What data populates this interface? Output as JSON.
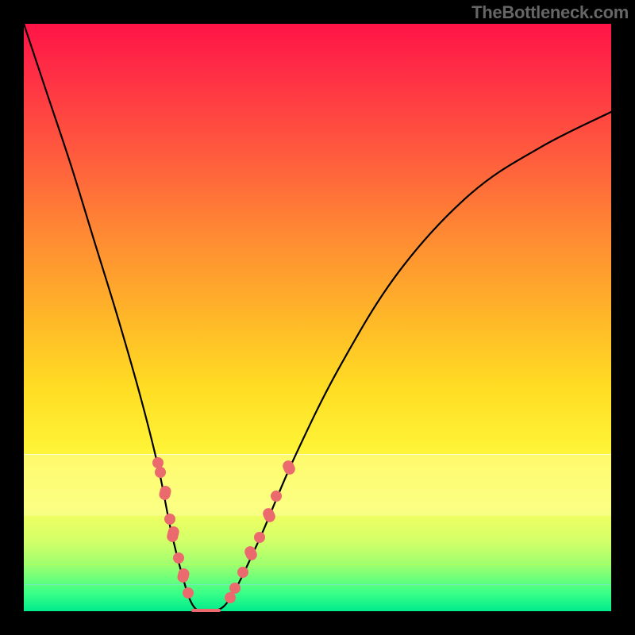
{
  "watermark": "TheBottleneck.com",
  "colors": {
    "dot": "#ea6a6e",
    "curve": "#000000",
    "gradient_top": "#ff1447",
    "gradient_bottom": "#00eb8c"
  },
  "chart_data": {
    "type": "line",
    "title": "",
    "xlabel": "",
    "ylabel": "",
    "xlim": [
      0,
      100
    ],
    "ylim": [
      0,
      100
    ],
    "series": [
      {
        "name": "bottleneck-curve",
        "x": [
          0,
          4,
          8,
          12,
          16,
          20,
          23,
          25,
          27,
          28.5,
          30,
          32,
          35,
          40,
          46,
          54,
          64,
          76,
          88,
          100
        ],
        "y": [
          100,
          88,
          76,
          63,
          50,
          36,
          24,
          14,
          6,
          1.5,
          0,
          0,
          2,
          12,
          26,
          42,
          58,
          71,
          79,
          85
        ]
      }
    ],
    "minimum_x_range": [
      28.5,
      33.5
    ],
    "highlighted_points_left": [
      {
        "x": 22.8,
        "y": 25.3
      },
      {
        "x": 23.2,
        "y": 23.6
      },
      {
        "x": 24.0,
        "y": 20.2,
        "len": 3.2
      },
      {
        "x": 24.8,
        "y": 15.7
      },
      {
        "x": 25.4,
        "y": 13.1,
        "len": 3.8
      },
      {
        "x": 26.3,
        "y": 9.0
      },
      {
        "x": 27.1,
        "y": 6.1,
        "len": 3.0
      },
      {
        "x": 28.0,
        "y": 3.1
      }
    ],
    "highlighted_points_right": [
      {
        "x": 35.2,
        "y": 2.3
      },
      {
        "x": 36.0,
        "y": 3.9
      },
      {
        "x": 37.3,
        "y": 6.6
      },
      {
        "x": 38.7,
        "y": 9.8,
        "len": 3.2
      },
      {
        "x": 40.2,
        "y": 12.6
      },
      {
        "x": 41.8,
        "y": 16.4,
        "len": 3.2
      },
      {
        "x": 43.0,
        "y": 19.6
      },
      {
        "x": 45.1,
        "y": 24.5,
        "len": 3.0
      }
    ]
  }
}
